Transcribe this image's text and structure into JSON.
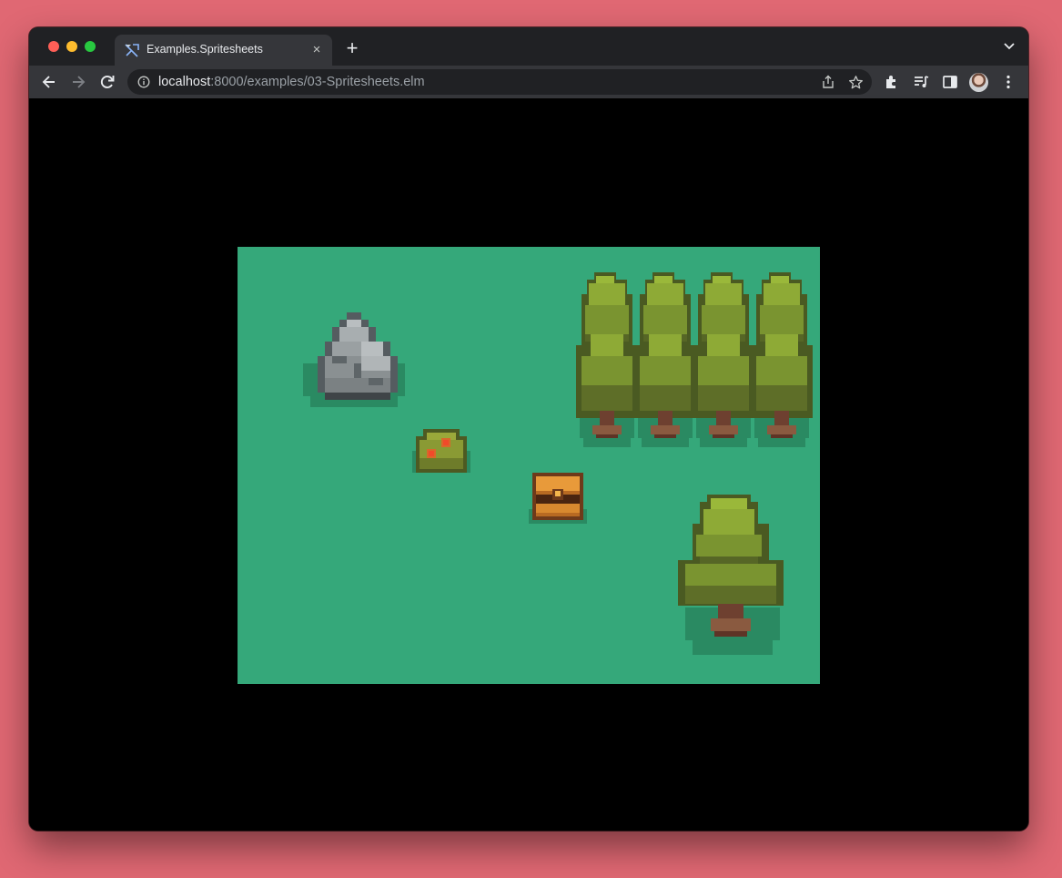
{
  "window": {
    "tab": {
      "title": "Examples.Spritesheets",
      "favicon": "elm-tangram-icon",
      "close_icon": "×"
    },
    "new_tab_icon": "+",
    "address_bar": {
      "host": "localhost",
      "rest": ":8000/examples/03-Spritesheets.elm"
    }
  },
  "game": {
    "background_color": "#35a87a",
    "sprites": [
      "rock",
      "bush",
      "treasure-chest",
      "tree-row",
      "tree"
    ]
  }
}
